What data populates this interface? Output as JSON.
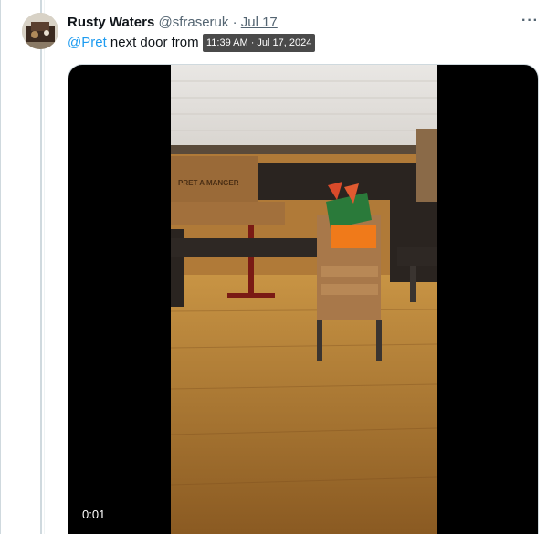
{
  "tweet": {
    "display_name": "Rusty Waters",
    "handle": "@sfraseruk",
    "separator": "·",
    "date": "Jul 17",
    "more_icon": "more-options-icon",
    "mention": "@Pret",
    "text_visible": " next door from ",
    "tooltip": "11:39 AM · Jul 17, 2024"
  },
  "video": {
    "elapsed": "0:01",
    "poster_sign_text": "PRET A MANGER"
  },
  "colors": {
    "link": "#1d9bf0",
    "muted": "#536471",
    "border": "#cfd9de"
  }
}
